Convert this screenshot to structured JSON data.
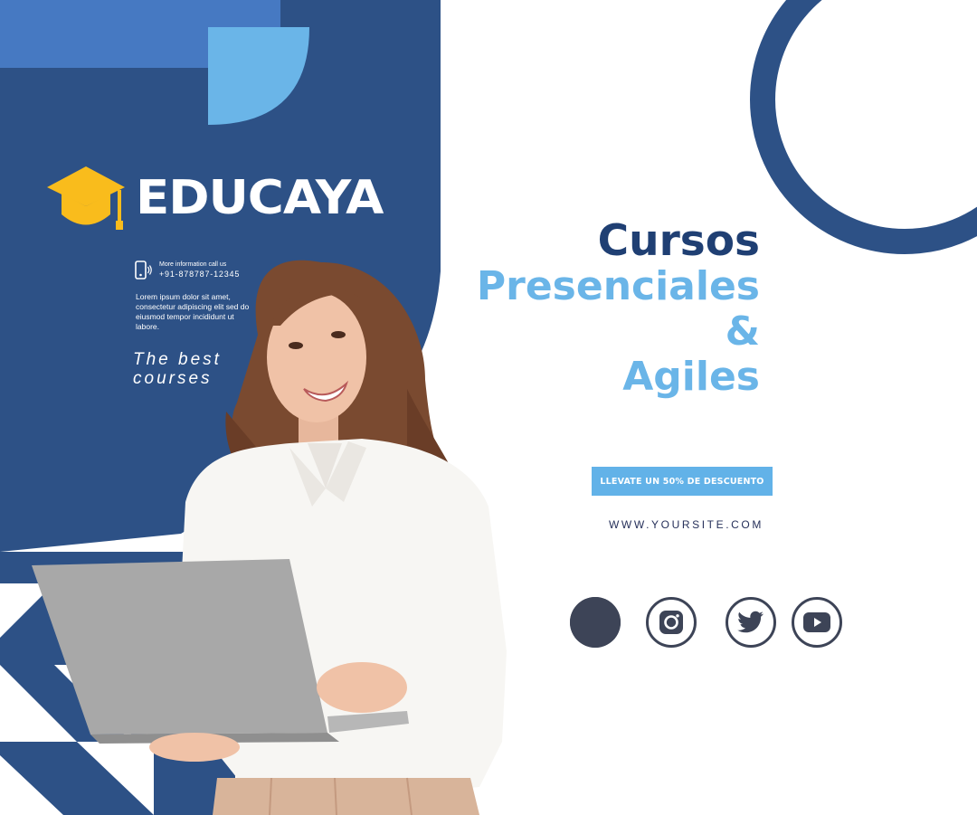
{
  "brand": {
    "name": "EDUCAYA"
  },
  "contact": {
    "info_label": "More information call us",
    "phone": "+91-878787-12345"
  },
  "description": "Lorem ipsum dolor sit amet, consectetur adipiscing elit sed do eiusmod tempor incididunt ut labore.",
  "tagline": {
    "line1": "The best",
    "line2": "courses"
  },
  "headline": {
    "line1": "Cursos",
    "line2": "Presenciales",
    "line3": "&",
    "line4": "Agiles"
  },
  "cta": {
    "label": "LLEVATE UN 50% DE DESCUENTO"
  },
  "website": "WWW.YOURSITE.COM",
  "social": [
    {
      "icon": "facebook-icon"
    },
    {
      "icon": "instagram-icon"
    },
    {
      "icon": "twitter-icon"
    },
    {
      "icon": "youtube-icon"
    }
  ],
  "colors": {
    "navy": "#2d5186",
    "light_blue": "#62b2e8",
    "top_bar": "#4679c2",
    "dark_headline": "#1f3f73",
    "logo_yellow": "#f9bc1c",
    "icon_dark": "#3d4457"
  }
}
